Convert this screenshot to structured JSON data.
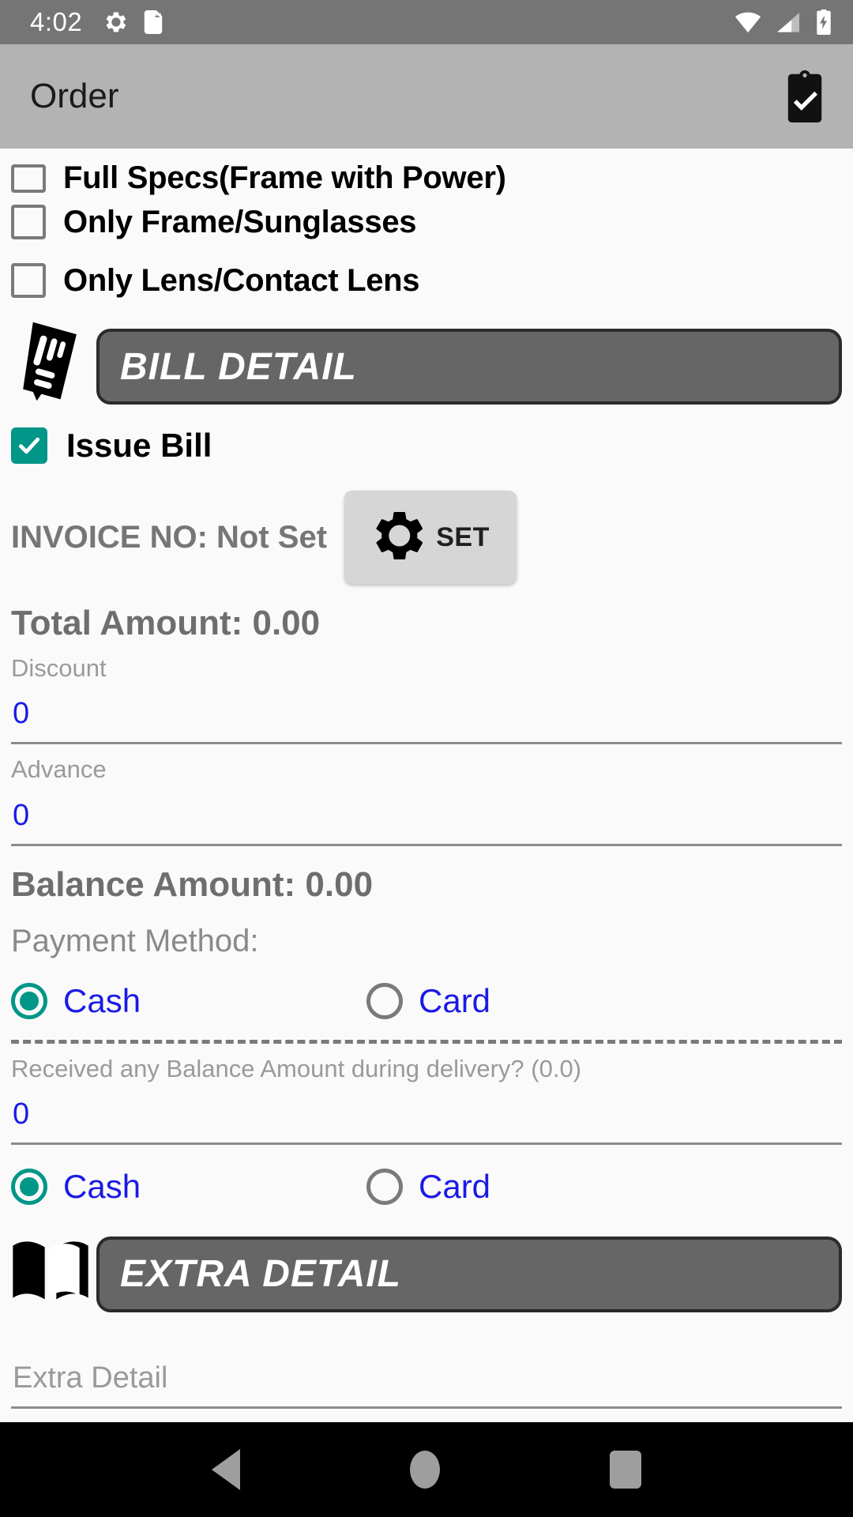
{
  "status_bar": {
    "time": "4:02",
    "left_icons": [
      "gear-icon",
      "sd-card-icon"
    ],
    "right_icons": [
      "wifi-icon",
      "cellular-signal-icon",
      "battery-charging-icon"
    ],
    "background": "#757575"
  },
  "app_bar": {
    "title": "Order",
    "action_icon": "clipboard-check-icon",
    "background": "#b3b3b3"
  },
  "order_type": {
    "options": [
      {
        "label": "Full Specs(Frame with Power)",
        "checked": false
      },
      {
        "label": "Only Frame/Sunglasses",
        "checked": false
      },
      {
        "label": "Only Lens/Contact Lens",
        "checked": false
      }
    ]
  },
  "bill_section": {
    "header": "BILL DETAIL",
    "header_icon": "receipt-icon",
    "issue_bill": {
      "label": "Issue Bill",
      "checked": true,
      "color": "#009688"
    },
    "invoice": {
      "text": "INVOICE NO: Not Set",
      "button_label": "SET",
      "button_icon": "gear-icon"
    },
    "total_amount": "Total Amount: 0.00",
    "discount": {
      "label": "Discount",
      "value": "0"
    },
    "advance": {
      "label": "Advance",
      "value": "0"
    },
    "balance_amount": "Balance Amount: 0.00",
    "payment_method_label": "Payment Method:",
    "payment_options": [
      {
        "label": "Cash",
        "selected": true
      },
      {
        "label": "Card",
        "selected": false
      }
    ],
    "delivery_question": "Received any Balance Amount during delivery? (0.0)",
    "delivery_value": "0",
    "delivery_payment_options": [
      {
        "label": "Cash",
        "selected": true
      },
      {
        "label": "Card",
        "selected": false
      }
    ]
  },
  "extra_section": {
    "header": "EXTRA DETAIL",
    "header_icon": "open-book-icon",
    "extra_detail": {
      "placeholder": "Extra Detail",
      "value": ""
    }
  },
  "nav_bar": {
    "back": "back-triangle-icon",
    "home": "home-circle-icon",
    "recents": "recents-square-icon"
  },
  "colors": {
    "accent_teal": "#009688",
    "input_blue": "#1a1ae6",
    "section_bar": "#666666",
    "muted_text": "#8a8a8a"
  }
}
